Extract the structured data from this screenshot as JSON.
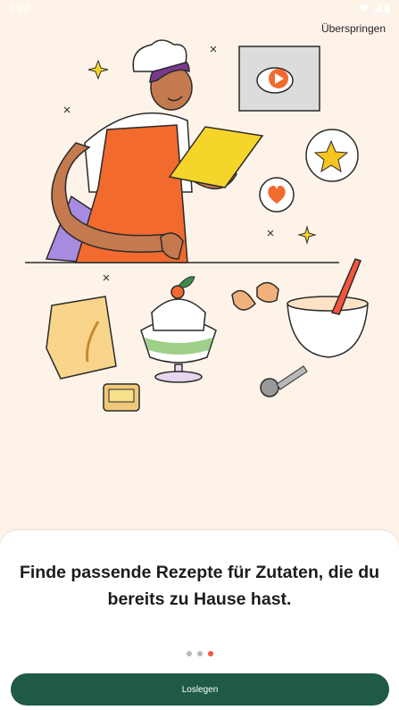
{
  "status_bar": {
    "time": "2:22"
  },
  "header": {
    "skip_label": "Überspringen"
  },
  "onboarding": {
    "headline": "Finde passende Rezepte für Zutaten, die du bereits zu Hause hast.",
    "page_indicator": {
      "total": 3,
      "active_index": 2
    },
    "cta_label": "Loslegen"
  },
  "colors": {
    "background": "#fdf3e8",
    "primary_button": "#1e5a46",
    "active_dot": "#f2543c",
    "inactive_dot": "#b9b9b9"
  },
  "icons": [
    "wifi-icon",
    "signal-icon",
    "battery-icon",
    "play-icon",
    "star-icon",
    "heart-icon",
    "sparkle-icon"
  ]
}
